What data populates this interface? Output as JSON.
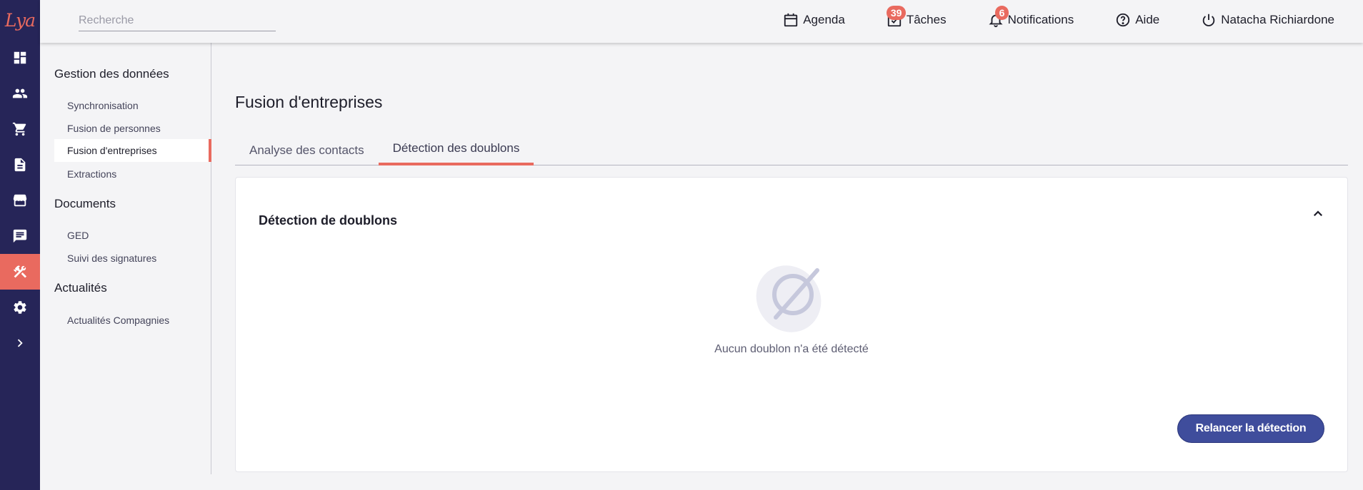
{
  "app": {
    "logo_text": "Lya"
  },
  "search": {
    "placeholder": "Recherche"
  },
  "topnav": {
    "agenda": "Agenda",
    "taches": "Tâches",
    "taches_count": "39",
    "notifications": "Notifications",
    "notifications_count": "6",
    "aide": "Aide",
    "user": "Natacha Richiardone"
  },
  "rail": {
    "items": [
      "dashboard-icon",
      "people-icon",
      "cart-icon",
      "document-icon",
      "store-icon",
      "chat-icon",
      "tools-icon",
      "gear-icon",
      "chevron-right-icon"
    ],
    "active": "tools-icon"
  },
  "sidebar": {
    "sections": [
      {
        "title": "Gestion des données",
        "items": [
          "Synchronisation",
          "Fusion de personnes",
          "Fusion d'entreprises",
          "Extractions"
        ]
      },
      {
        "title": "Documents",
        "items": [
          "GED",
          "Suivi des signatures"
        ]
      },
      {
        "title": "Actualités",
        "items": [
          "Actualités Compagnies"
        ]
      }
    ],
    "active_item": "Fusion d'entreprises"
  },
  "main": {
    "title": "Fusion d'entreprises",
    "tabs": [
      {
        "label": "Analyse des contacts",
        "active": false
      },
      {
        "label": "Détection des doublons",
        "active": true
      }
    ],
    "card": {
      "title": "Détection de doublons",
      "empty_message": "Aucun doublon n'a été détecté",
      "button_label": "Relancer la détection"
    }
  },
  "colors": {
    "rail_bg": "#262558",
    "accent": "#e96a5f",
    "primary_button": "#3f4d9c"
  }
}
